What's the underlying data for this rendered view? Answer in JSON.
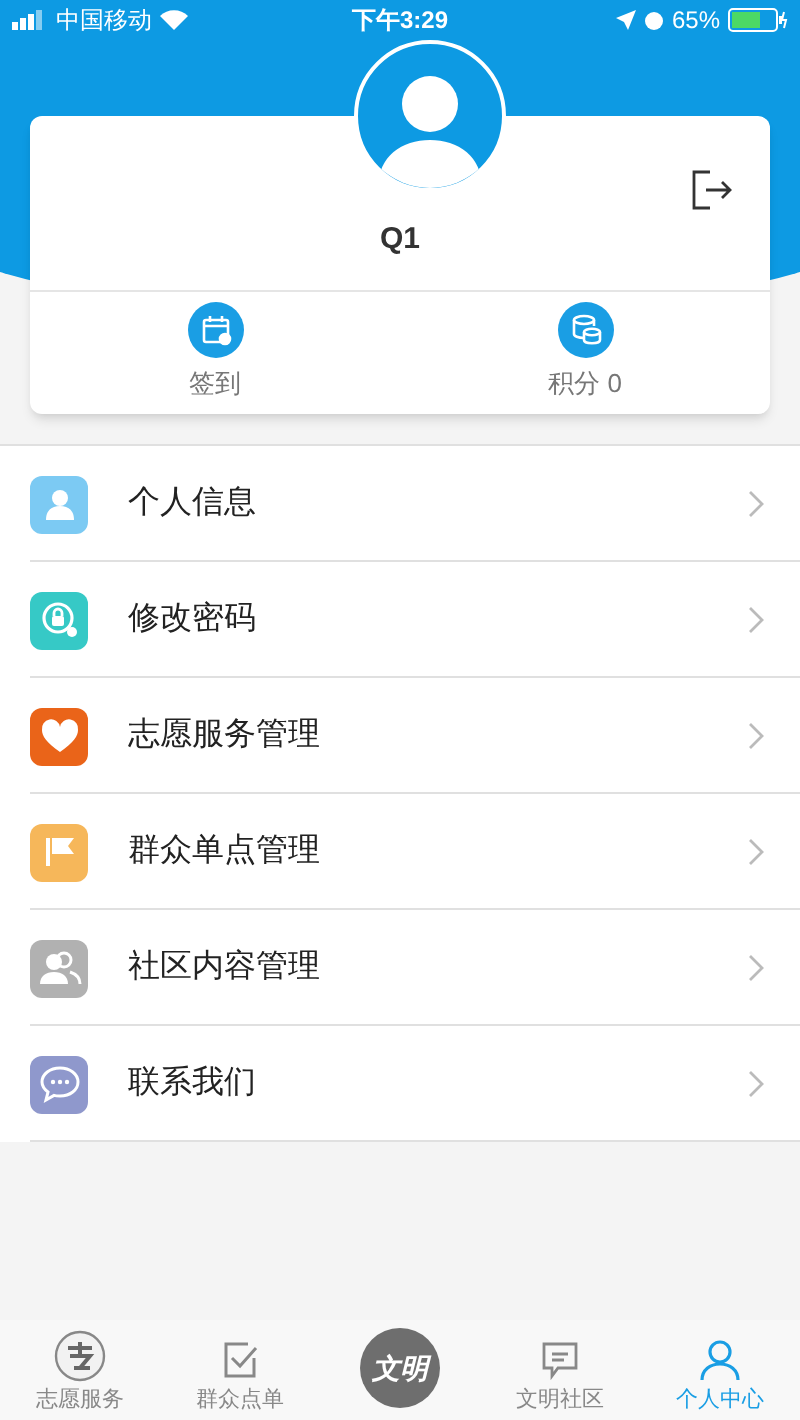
{
  "status_bar": {
    "carrier": "中国移动",
    "time": "下午3:29",
    "battery": "65%"
  },
  "profile": {
    "name": "Q1",
    "actions": [
      {
        "kind": "calendar",
        "label": "签到"
      },
      {
        "kind": "coins",
        "label": "积分 0"
      }
    ]
  },
  "menu": [
    {
      "kind": "person",
      "color": "#7ccaf3",
      "label": "个人信息"
    },
    {
      "kind": "lock",
      "color": "#36c9c6",
      "label": "修改密码"
    },
    {
      "kind": "heart",
      "color": "#ea6419",
      "label": "志愿服务管理"
    },
    {
      "kind": "flag",
      "color": "#f6b75a",
      "label": "群众单点管理"
    },
    {
      "kind": "people",
      "color": "#b1b1b1",
      "label": "社区内容管理"
    },
    {
      "kind": "chat",
      "color": "#8f98cc",
      "label": "联系我们"
    }
  ],
  "tab_bar": [
    {
      "kind": "badge",
      "label": "志愿服务",
      "selected": false
    },
    {
      "kind": "check",
      "label": "群众点单",
      "selected": false
    },
    {
      "kind": "center",
      "label": "文明",
      "selected": false
    },
    {
      "kind": "comment",
      "label": "文明社区",
      "selected": false
    },
    {
      "kind": "user",
      "label": "个人中心",
      "selected": true
    }
  ]
}
